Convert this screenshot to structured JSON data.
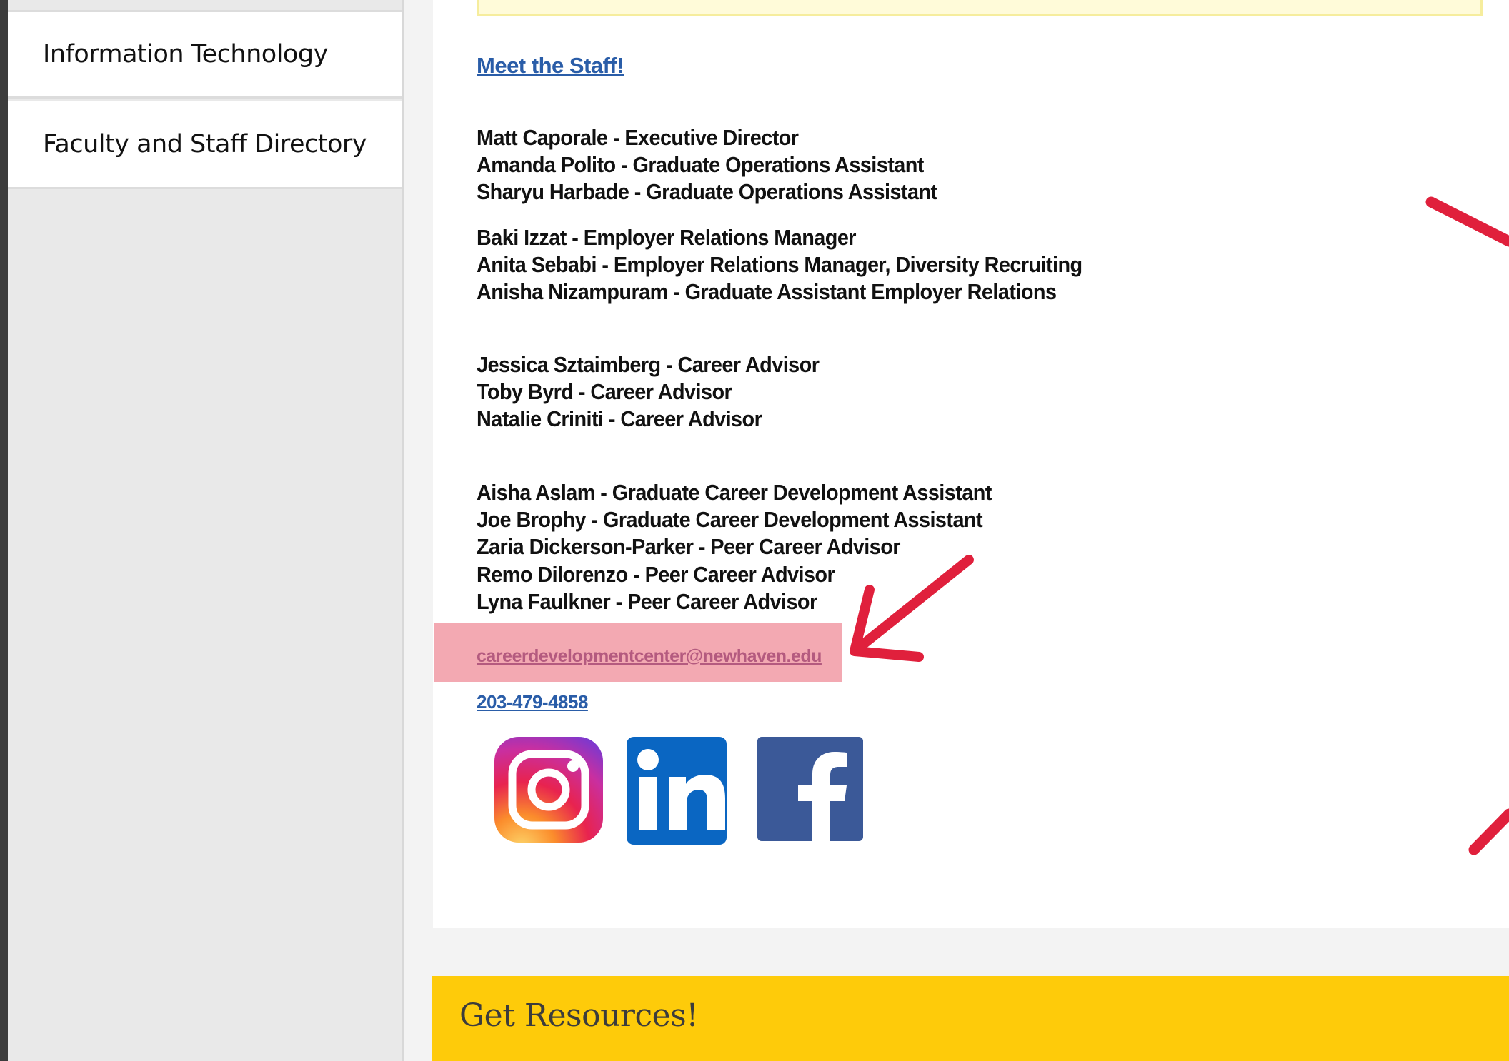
{
  "sidebar": {
    "items": [
      {
        "label": "Information Technology"
      },
      {
        "label": "Faculty and Staff Directory"
      }
    ]
  },
  "main": {
    "meet_link": "Meet the Staff!",
    "staff": [
      "Matt Caporale - Executive Director",
      "Amanda Polito - Graduate Operations Assistant",
      "Sharyu Harbade - Graduate Operations Assistant",
      "Baki Izzat - Employer Relations Manager",
      "Anita Sebabi - Employer Relations Manager, Diversity Recruiting",
      "Anisha Nizampuram - Graduate Assistant Employer Relations",
      "Jessica Sztaimberg - Career Advisor",
      "Toby Byrd - Career Advisor",
      "Natalie Criniti - Career Advisor",
      "Aisha Aslam - Graduate Career Development Assistant",
      "Joe Brophy - Graduate Career Development Assistant",
      "Zaria Dickerson-Parker - Peer Career Advisor",
      "Remo Dilorenzo - Peer Career Advisor",
      "Lyna Faulkner - Peer Career Advisor"
    ],
    "email": "careerdevelopmentcenter@newhaven.edu",
    "phone": "203-479-4858",
    "social": {
      "instagram_icon": "instagram-icon",
      "linkedin_icon": "linkedin-icon",
      "facebook_icon": "facebook-icon"
    }
  },
  "banner": {
    "title": "Get Resources!"
  },
  "colors": {
    "banner": "#fecb0a",
    "link": "#2a5da8",
    "annotation": "#e0203c",
    "highlight": "#f2a0aa",
    "linkedin": "#0a66c2",
    "facebook": "#3b5998"
  }
}
